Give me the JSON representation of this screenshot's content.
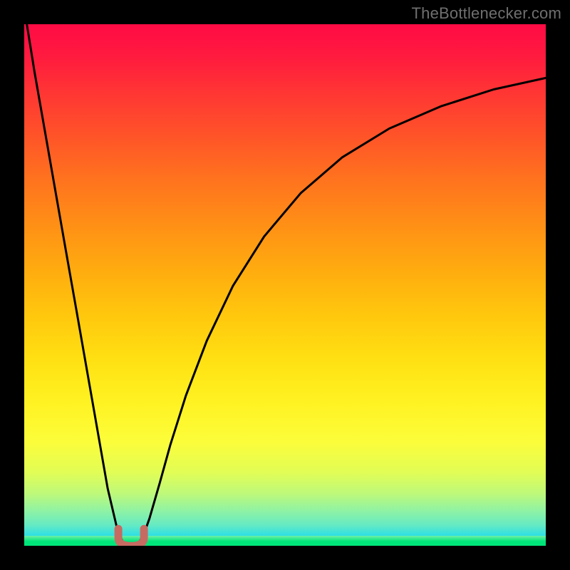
{
  "watermark": {
    "text": "TheBottlenecker.com"
  },
  "chart_data": {
    "type": "line",
    "title": "",
    "xlabel": "",
    "ylabel": "",
    "xlim": [
      0,
      100
    ],
    "ylim": [
      0,
      100
    ],
    "background_gradient": {
      "orientation": "vertical",
      "stops": [
        {
          "pos": 0,
          "color": "#ff0b45"
        },
        {
          "pos": 21,
          "color": "#ff5229"
        },
        {
          "pos": 47,
          "color": "#ffab0f"
        },
        {
          "pos": 73,
          "color": "#fff324"
        },
        {
          "pos": 90,
          "color": "#bef97a"
        },
        {
          "pos": 100,
          "color": "#0ad6fb"
        }
      ]
    },
    "series": [
      {
        "name": "bottleneck-curve",
        "color": "#000000",
        "x": [
          0.5,
          2,
          4,
          6,
          8,
          10,
          12,
          14,
          16,
          18,
          19,
          20,
          21,
          22,
          23,
          24,
          26,
          28,
          31,
          35,
          40,
          46,
          53,
          61,
          70,
          80,
          90,
          100
        ],
        "y": [
          100,
          90.7,
          79.3,
          67.9,
          56.5,
          45.2,
          33.8,
          22.4,
          11.0,
          2.5,
          0.6,
          0.0,
          0.0,
          0.6,
          2.4,
          5.2,
          12.1,
          19.3,
          28.8,
          39.3,
          49.8,
          59.3,
          67.6,
          74.5,
          80.0,
          84.3,
          87.5,
          89.7
        ]
      },
      {
        "name": "valley-marker",
        "color": "#c76a62",
        "type": "marker-path",
        "note": "small U-shaped marker at curve minimum",
        "center_x": 20.5,
        "center_y": 0.5
      }
    ]
  }
}
